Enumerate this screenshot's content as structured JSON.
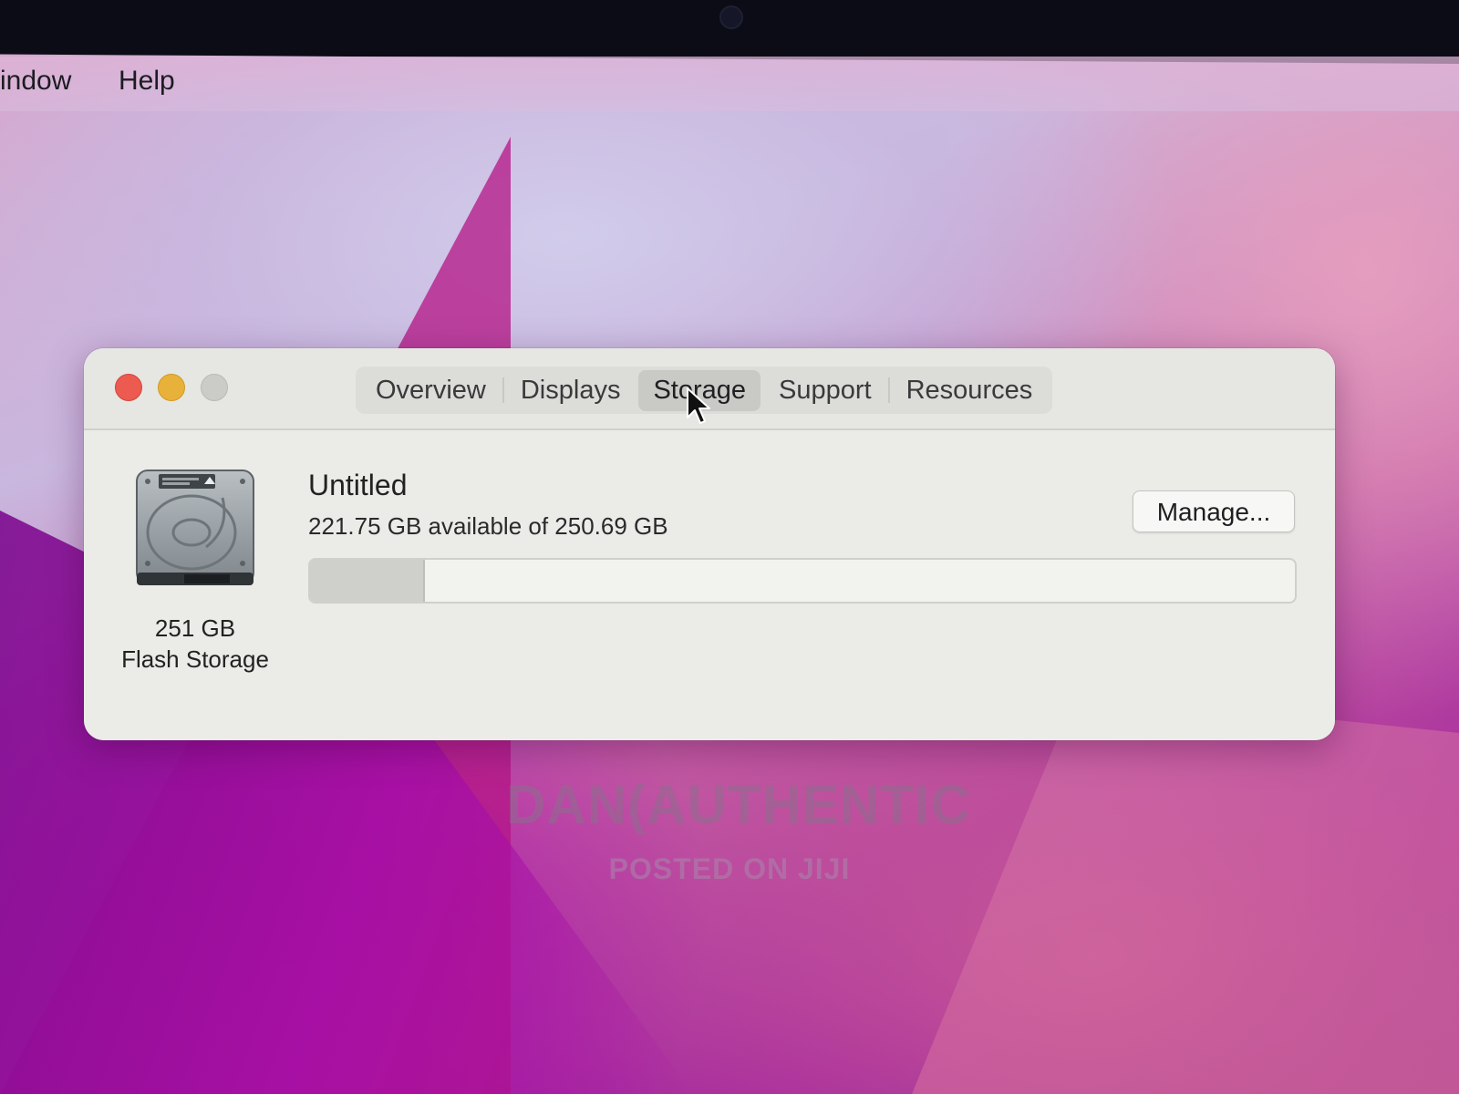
{
  "menubar": {
    "items": [
      {
        "label": "indow"
      },
      {
        "label": "Help"
      }
    ]
  },
  "window": {
    "tabs": [
      {
        "label": "Overview",
        "selected": false
      },
      {
        "label": "Displays",
        "selected": false
      },
      {
        "label": "Storage",
        "selected": true
      },
      {
        "label": "Support",
        "selected": false
      },
      {
        "label": "Resources",
        "selected": false
      }
    ],
    "disk": {
      "icon": "hard-drive-icon",
      "capacity": "251 GB",
      "type": "Flash Storage"
    },
    "volume": {
      "name": "Untitled",
      "availability": "221.75 GB available of 250.69 GB",
      "used_fraction": 0.115
    },
    "manage_label": "Manage..."
  },
  "watermark": {
    "main": "DAN(AUTHENTIC",
    "sub": "POSTED ON JIJI"
  },
  "colors": {
    "close": "#ec5a50",
    "minimize": "#e8b23a",
    "zoom": "#cbcbc8"
  }
}
